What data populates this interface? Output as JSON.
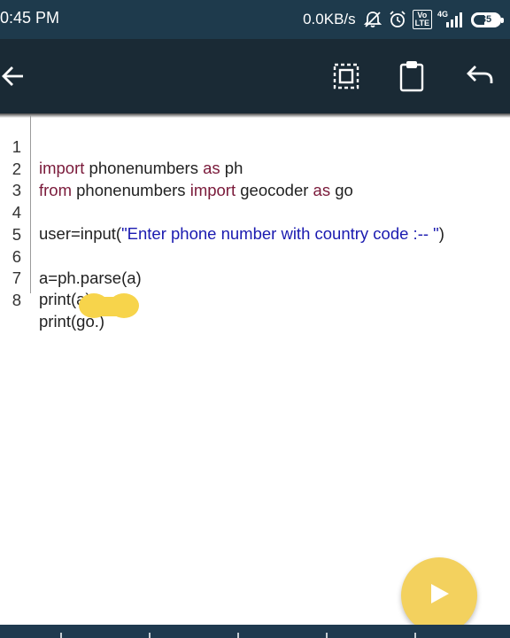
{
  "status_bar": {
    "time": "0:45 PM",
    "net_speed": "0.0KB/s",
    "icons": [
      "mute-alarm-icon",
      "alarm-icon",
      "volte-icon",
      "signal-4g-icon",
      "battery-icon"
    ],
    "volte_label": "Vo\nLTE",
    "network_label": "4G",
    "battery_level": "35"
  },
  "toolbar": {
    "icons": [
      "back-arrow-icon",
      "select-all-icon",
      "clipboard-icon",
      "undo-icon"
    ]
  },
  "editor": {
    "lines": [
      {
        "number": "1",
        "parts": [
          {
            "t": "import",
            "k": "kw"
          },
          {
            "t": " phonenumbers ",
            "k": ""
          },
          {
            "t": "as",
            "k": "kw"
          },
          {
            "t": " ph",
            "k": ""
          }
        ]
      },
      {
        "number": "2",
        "parts": [
          {
            "t": "from",
            "k": "kw"
          },
          {
            "t": " phonenumbers ",
            "k": ""
          },
          {
            "t": "import",
            "k": "kw"
          },
          {
            "t": " geocoder ",
            "k": ""
          },
          {
            "t": "as",
            "k": "kw"
          },
          {
            "t": " go",
            "k": ""
          }
        ]
      },
      {
        "number": "3",
        "parts": []
      },
      {
        "number": "4",
        "parts": [
          {
            "t": "user=input(",
            "k": ""
          },
          {
            "t": "\"Enter phone number with country code :-- \"",
            "k": "str"
          },
          {
            "t": ")",
            "k": ""
          }
        ]
      },
      {
        "number": "5",
        "parts": []
      },
      {
        "number": "6",
        "parts": [
          {
            "t": "a=ph.parse(a)",
            "k": ""
          }
        ]
      },
      {
        "number": "7",
        "parts": [
          {
            "t": "print(a)",
            "k": ""
          }
        ]
      },
      {
        "number": "8",
        "parts": [
          {
            "t": "print(go.)",
            "k": ""
          }
        ]
      }
    ]
  },
  "run_button": {
    "icon": "play-icon"
  },
  "colors": {
    "status_bar_bg": "#1e3a4c",
    "toolbar_bg": "#1a2a35",
    "keyword": "#7a1a3a",
    "string": "#1a1ab0",
    "fab": "#f3d15e",
    "touch_indicator": "#f7d44b"
  }
}
